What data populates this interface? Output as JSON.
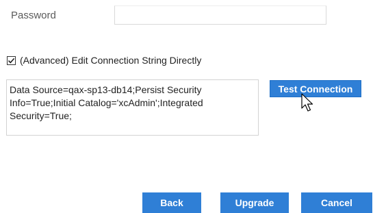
{
  "form": {
    "password": {
      "label": "Password",
      "value": ""
    },
    "advanced": {
      "checked": true,
      "label": "(Advanced) Edit Connection String Directly"
    },
    "connection_string": "Data Source=qax-sp13-db14;Persist Security Info=True;Initial Catalog='xcAdmin';Integrated Security=True;"
  },
  "buttons": {
    "test_connection": "Test Connection",
    "back": "Back",
    "upgrade": "Upgrade",
    "cancel": "Cancel"
  },
  "colors": {
    "accent": "#2f7fd6",
    "button_text": "#ffffff"
  },
  "icons": {
    "checkbox": "checkmark-icon",
    "pointer": "mouse-pointer-icon"
  }
}
